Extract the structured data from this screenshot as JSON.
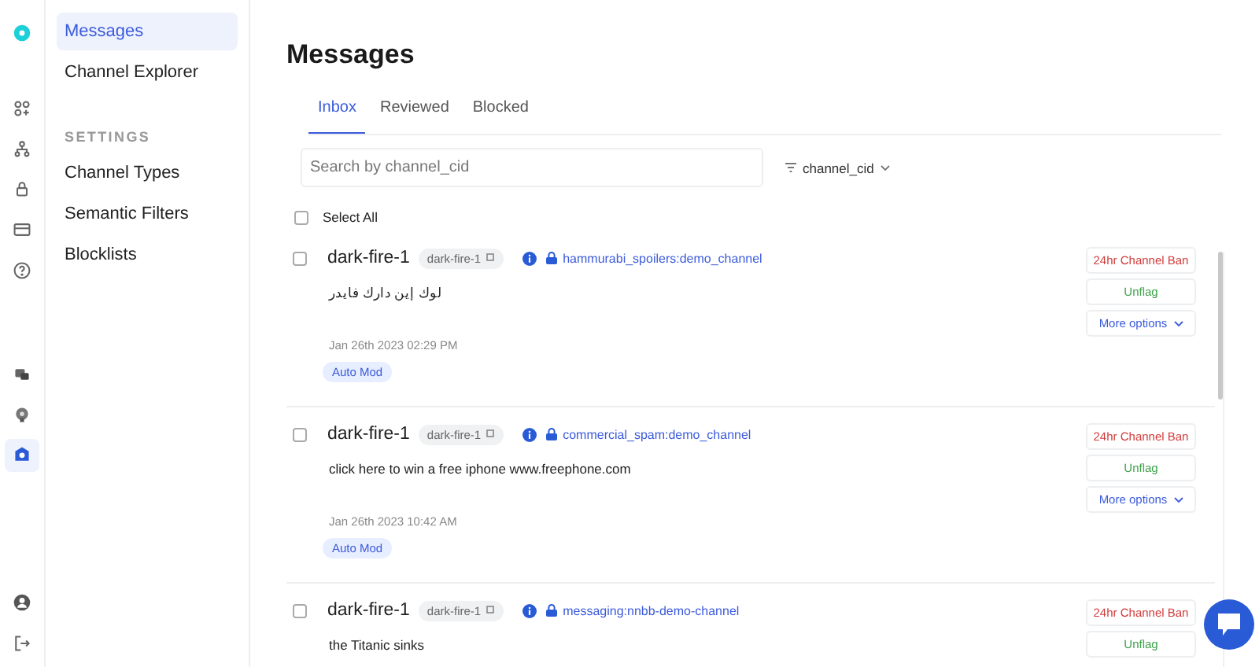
{
  "rail": [
    {
      "kind": "logo",
      "selected": false
    },
    {
      "kind": "apps",
      "selected": false
    },
    {
      "kind": "users",
      "selected": false
    },
    {
      "kind": "lock",
      "selected": false
    },
    {
      "kind": "card",
      "selected": false
    },
    {
      "kind": "help",
      "selected": false
    },
    {
      "kind": "chat",
      "selected": false
    },
    {
      "kind": "support",
      "selected": false
    },
    {
      "kind": "moderation",
      "selected": true
    },
    {
      "kind": "account",
      "selected": false
    },
    {
      "kind": "logout",
      "selected": false
    }
  ],
  "nav": {
    "items": [
      {
        "label": "Messages",
        "selected": true
      },
      {
        "label": "Channel Explorer",
        "selected": false
      }
    ],
    "settings_heading": "SETTINGS",
    "settings_items": [
      {
        "label": "Channel Types",
        "selected": false
      },
      {
        "label": "Semantic Filters",
        "selected": false
      },
      {
        "label": "Blocklists",
        "selected": false
      }
    ]
  },
  "title": "Messages",
  "tabs": [
    {
      "label": "Inbox",
      "selected": true
    },
    {
      "label": "Reviewed",
      "selected": false
    },
    {
      "label": "Blocked",
      "selected": false
    }
  ],
  "search": {
    "placeholder": "Search by channel_cid"
  },
  "filter": {
    "label": "channel_cid"
  },
  "select_all": {
    "label": "Select All",
    "checked": false
  },
  "messages": [
    {
      "user": "dark-fire-1",
      "user_tag": "dark-fire-1",
      "channel": "hammurabi_spoilers:demo_channel",
      "text": "لوك إين دارك فايدر",
      "time": "Jan 26th 2023 02:29 PM",
      "badge": "Auto Mod",
      "checked": false,
      "actions": {
        "ban": "24hr Channel Ban",
        "unflag": "Unflag",
        "more": "More options"
      }
    },
    {
      "user": "dark-fire-1",
      "user_tag": "dark-fire-1",
      "channel": "commercial_spam:demo_channel",
      "text": "click here to win a free iphone www.freephone.com",
      "time": "Jan 26th 2023 10:42 AM",
      "badge": "Auto Mod",
      "checked": false,
      "actions": {
        "ban": "24hr Channel Ban",
        "unflag": "Unflag",
        "more": "More options"
      }
    },
    {
      "user": "dark-fire-1",
      "user_tag": "dark-fire-1",
      "channel": "messaging:nnbb-demo-channel",
      "text": "the Titanic sinks",
      "checked": false,
      "actions": {
        "ban": "24hr Channel Ban",
        "unflag": "Unflag"
      }
    }
  ]
}
